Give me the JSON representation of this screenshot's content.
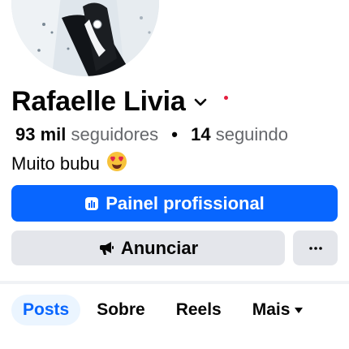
{
  "profile": {
    "name": "Rafaelle Livia",
    "followers_count": "93 mil",
    "followers_label": "seguidores",
    "separator": "•",
    "following_count": "14",
    "following_label": "seguindo",
    "bio": "Muito bubu",
    "bio_emoji": "😍"
  },
  "buttons": {
    "dashboard_label": "Painel profissional",
    "advertise_label": "Anunciar",
    "more_label": "···"
  },
  "tabs": [
    {
      "label": "Posts",
      "active": true
    },
    {
      "label": "Sobre",
      "active": false
    },
    {
      "label": "Reels",
      "active": false
    },
    {
      "label": "Mais",
      "active": false
    }
  ],
  "icons": {
    "camera": "camera-icon",
    "chevron": "chevron-down-icon",
    "dashboard": "dashboard-icon",
    "megaphone": "megaphone-icon",
    "more": "more-icon",
    "caret": "caret-down-icon"
  },
  "colors": {
    "primary": "#0866ff",
    "secondary_bg": "#e4e6eb",
    "notification_dot": "#e41e3f",
    "active_tab_bg": "#ebf5ff"
  }
}
